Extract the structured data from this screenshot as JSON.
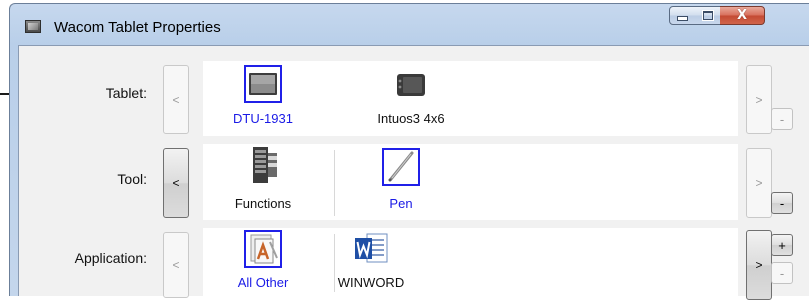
{
  "window": {
    "title": "Wacom Tablet Properties",
    "controls": {
      "minimize": "minimize",
      "maximize": "maximize",
      "close": "X"
    }
  },
  "rows": {
    "tablet": {
      "label": "Tablet:",
      "prev": "<",
      "next": ">",
      "items": [
        {
          "name": "DTU-1931",
          "icon": "display-tablet-icon",
          "selected": true
        },
        {
          "name": "Intuos3 4x6",
          "icon": "tablet-icon",
          "selected": false
        }
      ],
      "remove": "-"
    },
    "tool": {
      "label": "Tool:",
      "prev": "<",
      "next": ">",
      "items": [
        {
          "name": "Functions",
          "icon": "functions-icon",
          "selected": false
        },
        {
          "name": "Pen",
          "icon": "pen-icon",
          "selected": true
        }
      ],
      "remove": "-"
    },
    "application": {
      "label": "Application:",
      "prev": "<",
      "next": ">",
      "items": [
        {
          "name": "All Other",
          "icon": "all-other-apps-icon",
          "selected": true
        },
        {
          "name": "WINWORD",
          "icon": "word-icon",
          "selected": false
        }
      ],
      "add": "+",
      "remove": "-"
    }
  },
  "colors": {
    "selection": "#2020e8",
    "titlebar": "#b9cfe9",
    "close_button": "#c44a33"
  }
}
